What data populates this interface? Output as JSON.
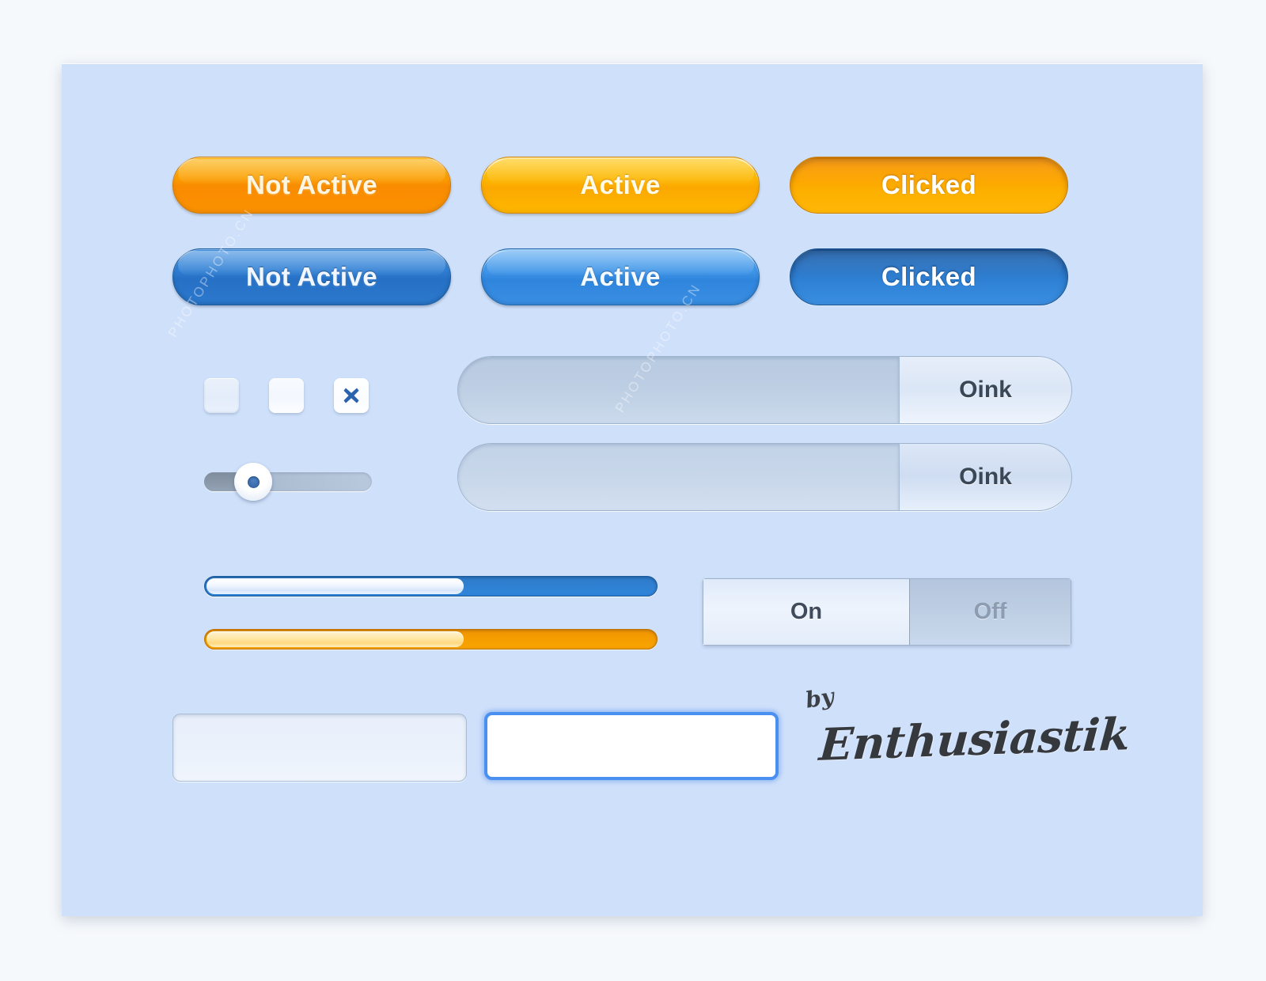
{
  "panel": {
    "background_color": "#cfe0fa",
    "page_background_color": "#f6f9fc"
  },
  "buttons": {
    "orange": [
      {
        "label": "Not Active",
        "state": "not-active",
        "color": "#fb9e00"
      },
      {
        "label": "Active",
        "state": "active",
        "color": "#fdb600"
      },
      {
        "label": "Clicked",
        "state": "clicked",
        "color": "#f8a000"
      }
    ],
    "blue": [
      {
        "label": "Not Active",
        "state": "not-active",
        "color": "#2f7fd4"
      },
      {
        "label": "Active",
        "state": "active",
        "color": "#3f95e8"
      },
      {
        "label": "Clicked",
        "state": "clicked",
        "color": "#2a71bf"
      }
    ]
  },
  "checkboxes": [
    {
      "state": "unchecked",
      "icon": ""
    },
    {
      "state": "unchecked-hover",
      "icon": ""
    },
    {
      "state": "checked",
      "icon": "cross-icon"
    }
  ],
  "slider": {
    "value_percent": 32,
    "handle_icon": "slider-handle-dot"
  },
  "dropdowns": [
    {
      "label": "Oink",
      "state": "hover",
      "value": ""
    },
    {
      "label": "Oink",
      "state": "normal",
      "value": ""
    }
  ],
  "progress_bars": [
    {
      "variant": "blue",
      "value_percent": 57,
      "color": "#2f7fd0"
    },
    {
      "variant": "orange",
      "value_percent": 57,
      "color": "#f59c00"
    }
  ],
  "toggle": {
    "on_label": "On",
    "off_label": "Off",
    "selected": "On"
  },
  "text_inputs": [
    {
      "state": "normal",
      "value": "",
      "placeholder": ""
    },
    {
      "state": "focused",
      "value": "",
      "placeholder": ""
    }
  ],
  "logo": {
    "prefix": "by",
    "name": "Enthusiastik"
  },
  "watermarks": {
    "mark_a": "PHOTOPHOTO.CN",
    "mark_b": "PHOTOPHOTO.CN"
  }
}
